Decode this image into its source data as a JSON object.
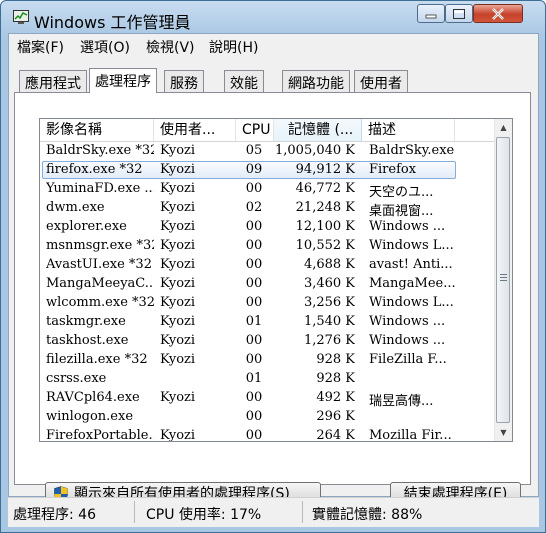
{
  "window": {
    "title": "Windows 工作管理員"
  },
  "menu": [
    {
      "label": "檔案(F)"
    },
    {
      "label": "選項(O)"
    },
    {
      "label": "檢視(V)"
    },
    {
      "label": "說明(H)"
    }
  ],
  "tabs": [
    {
      "label": "應用程式"
    },
    {
      "label": "處理程序"
    },
    {
      "label": "服務"
    },
    {
      "label": "效能"
    },
    {
      "label": "網路功能"
    },
    {
      "label": "使用者"
    }
  ],
  "active_tab": "處理程序",
  "columns": [
    {
      "label": "影像名稱"
    },
    {
      "label": "使用者..."
    },
    {
      "label": "CPU"
    },
    {
      "label": "記憶體 (..."
    },
    {
      "label": "描述"
    }
  ],
  "processes": [
    {
      "name": "BaldrSky.exe *32",
      "user": "Kyozi",
      "cpu": "05",
      "mem": "1,005,040 K",
      "desc": "BaldrSky.exe"
    },
    {
      "name": "firefox.exe *32",
      "user": "Kyozi",
      "cpu": "09",
      "mem": "94,912 K",
      "desc": "Firefox"
    },
    {
      "name": "YuminaFD.exe ...",
      "user": "Kyozi",
      "cpu": "00",
      "mem": "46,772 K",
      "desc": "天空のユ..."
    },
    {
      "name": "dwm.exe",
      "user": "Kyozi",
      "cpu": "02",
      "mem": "21,248 K",
      "desc": "桌面視窗..."
    },
    {
      "name": "explorer.exe",
      "user": "Kyozi",
      "cpu": "00",
      "mem": "12,100 K",
      "desc": "Windows ..."
    },
    {
      "name": "msnmsgr.exe *32",
      "user": "Kyozi",
      "cpu": "00",
      "mem": "10,552 K",
      "desc": "Windows L..."
    },
    {
      "name": "AvastUI.exe *32",
      "user": "Kyozi",
      "cpu": "00",
      "mem": "4,688 K",
      "desc": "avast! Anti..."
    },
    {
      "name": "MangaMeeyaC...",
      "user": "Kyozi",
      "cpu": "00",
      "mem": "3,460 K",
      "desc": "MangaMee..."
    },
    {
      "name": "wlcomm.exe *32",
      "user": "Kyozi",
      "cpu": "00",
      "mem": "3,256 K",
      "desc": "Windows L..."
    },
    {
      "name": "taskmgr.exe",
      "user": "Kyozi",
      "cpu": "01",
      "mem": "1,540 K",
      "desc": "Windows ..."
    },
    {
      "name": "taskhost.exe",
      "user": "Kyozi",
      "cpu": "00",
      "mem": "1,276 K",
      "desc": "Windows ..."
    },
    {
      "name": "filezilla.exe *32",
      "user": "Kyozi",
      "cpu": "00",
      "mem": "928 K",
      "desc": "FileZilla F..."
    },
    {
      "name": "csrss.exe",
      "user": "",
      "cpu": "01",
      "mem": "928 K",
      "desc": ""
    },
    {
      "name": "RAVCpl64.exe",
      "user": "Kyozi",
      "cpu": "00",
      "mem": "492 K",
      "desc": "瑞昱高傳..."
    },
    {
      "name": "winlogon.exe",
      "user": "",
      "cpu": "00",
      "mem": "296 K",
      "desc": ""
    },
    {
      "name": "FirefoxPortable...",
      "user": "Kyozi",
      "cpu": "00",
      "mem": "264 K",
      "desc": "Mozilla Fir..."
    }
  ],
  "selected_process": "firefox.exe *32",
  "buttons": {
    "show_all": "顯示來自所有使用者的處理程序(S)",
    "end_process": "結束處理程序(E)"
  },
  "status": {
    "processes": "處理程序: 46",
    "cpu": "CPU 使用率: 17%",
    "memory": "實體記憶體: 88%"
  }
}
